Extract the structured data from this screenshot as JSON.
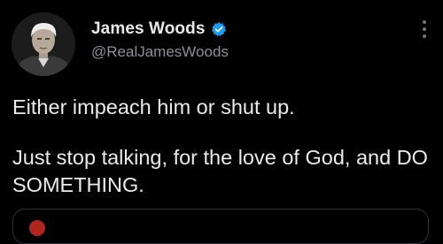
{
  "tweet": {
    "author_name": "James Woods",
    "author_handle": "@RealJamesWoods",
    "verified": true,
    "paragraphs": [
      "Either impeach him or shut up.",
      "Just stop talking, for the love of God, and DO SOMETHING."
    ]
  },
  "icons": {
    "verified": "verified-badge-icon",
    "more": "more-options-icon"
  },
  "colors": {
    "background": "#000000",
    "text": "#e7e9ea",
    "secondary_text": "#8b9197",
    "verified_blue": "#1d9bf0"
  }
}
